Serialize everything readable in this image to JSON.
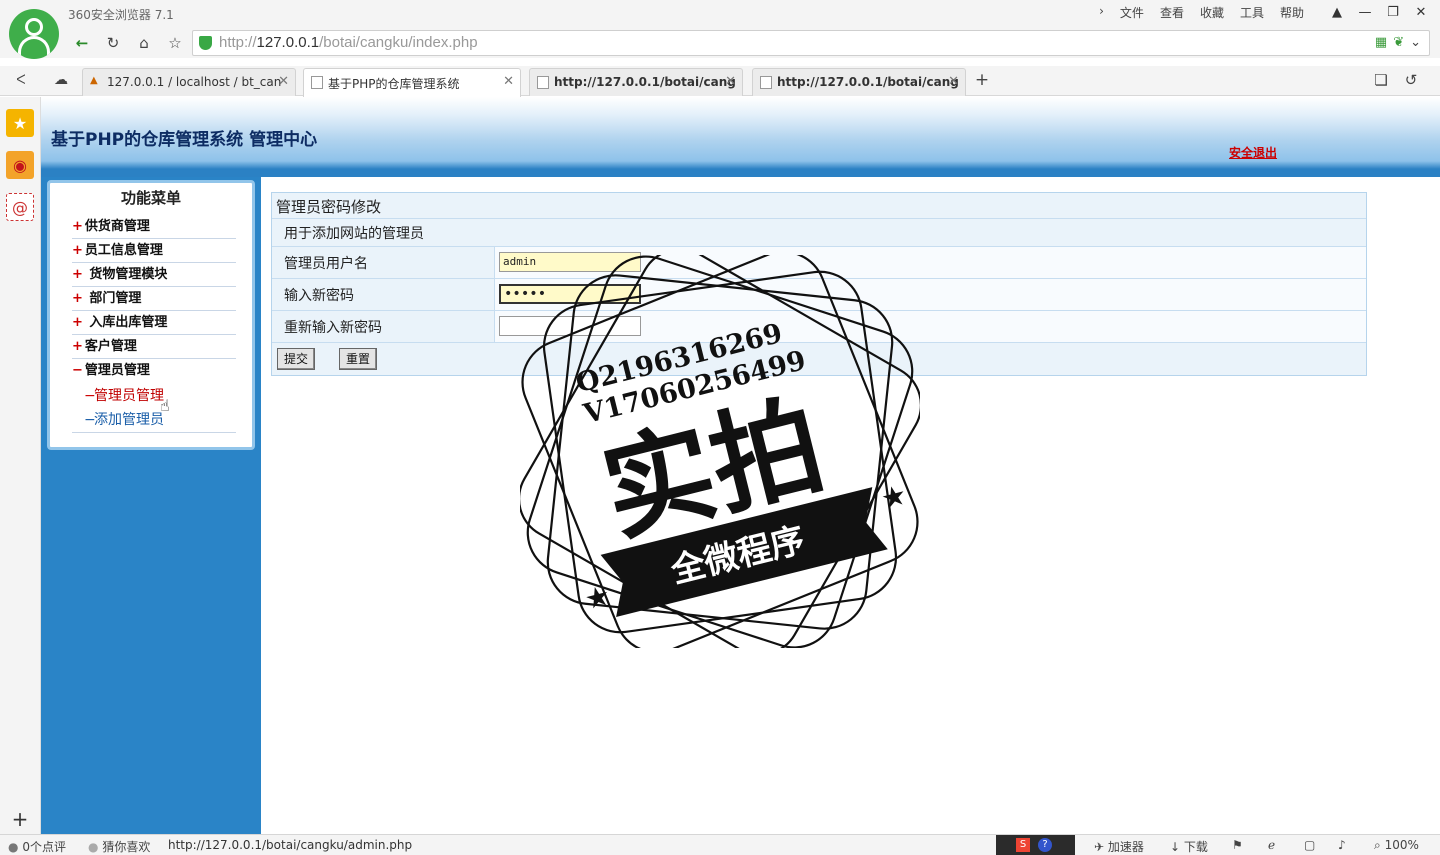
{
  "browser": {
    "app_title": "360安全浏览器 7.1",
    "menu": [
      "文件",
      "查看",
      "收藏",
      "工具",
      "帮助"
    ],
    "url_prefix": "http://",
    "url_host": "127.0.0.1",
    "url_path": "/botai/cangku/index.php",
    "tabs": [
      {
        "label": "127.0.0.1 / localhost / bt_can"
      },
      {
        "label": "基于PHP的仓库管理系统"
      },
      {
        "label": "http://127.0.0.1/botai/cang"
      },
      {
        "label": "http://127.0.0.1/botai/cang"
      }
    ],
    "status": {
      "comments": "0个点评",
      "guess": "猜你喜欢",
      "link": "http://127.0.0.1/botai/cangku/admin.php",
      "accelerator": "加速器",
      "download": "下载",
      "zoom": "100%"
    }
  },
  "page": {
    "header_title": "基于PHP的仓库管理系统 管理中心",
    "logout": "安全退出",
    "menu_title": "功能菜单",
    "menu_items": [
      {
        "sign": "+",
        "label": "供货商管理"
      },
      {
        "sign": "+",
        "label": "员工信息管理"
      },
      {
        "sign": "+",
        "label": " 货物管理模块"
      },
      {
        "sign": "+",
        "label": " 部门管理"
      },
      {
        "sign": "+",
        "label": " 入库出库管理"
      },
      {
        "sign": "+",
        "label": "客户管理"
      },
      {
        "sign": "−",
        "label": "管理员管理"
      }
    ],
    "sub_items": [
      {
        "dash": "−",
        "label": "管理员管理",
        "color": "#c00000"
      },
      {
        "dash": "−",
        "label": "添加管理员",
        "color": "#1a5ea8"
      }
    ],
    "form": {
      "title": "管理员密码修改",
      "subtitle": "用于添加网站的管理员",
      "username_label": "管理员用户名",
      "username_value": "admin",
      "new_password_label": "输入新密码",
      "new_password_value": "•••••",
      "confirm_password_label": "重新输入新密码",
      "confirm_password_value": "",
      "submit": "提交",
      "reset": "重置"
    },
    "watermark": {
      "line1": "Q2196316269",
      "line2": "V17060256499",
      "main": "实拍",
      "banner": "全微程序"
    }
  },
  "colors": {
    "left_panel": "#2a84c7",
    "header_title": "#0d2c63",
    "logout": "#cc0000",
    "logo": "#3fae4a"
  }
}
